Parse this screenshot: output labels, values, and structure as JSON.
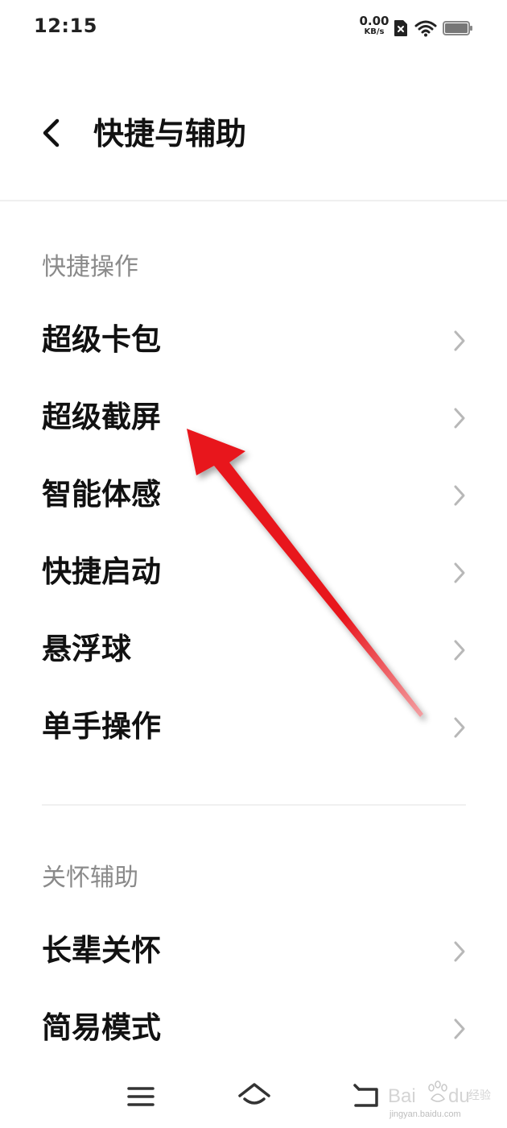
{
  "status_bar": {
    "time": "12:15",
    "net_speed_value": "0.00",
    "net_speed_unit": "KB/s",
    "icons": [
      "sim-error-icon",
      "wifi-icon",
      "battery-icon"
    ]
  },
  "header": {
    "back_icon": "chevron-left-icon",
    "title": "快捷与辅助"
  },
  "sections": [
    {
      "title": "快捷操作",
      "items": [
        {
          "label": "超级卡包"
        },
        {
          "label": "超级截屏"
        },
        {
          "label": "智能体感"
        },
        {
          "label": "快捷启动"
        },
        {
          "label": "悬浮球"
        },
        {
          "label": "单手操作"
        }
      ]
    },
    {
      "title": "关怀辅助",
      "items": [
        {
          "label": "长辈关怀"
        },
        {
          "label": "简易模式"
        }
      ]
    }
  ],
  "nav_bar": {
    "icons": [
      "menu-icon",
      "home-icon",
      "back-icon"
    ]
  },
  "annotation": {
    "color": "#e8141b",
    "points_to": "超级截屏"
  },
  "watermark": {
    "text": "jingyan.baidu.com"
  }
}
